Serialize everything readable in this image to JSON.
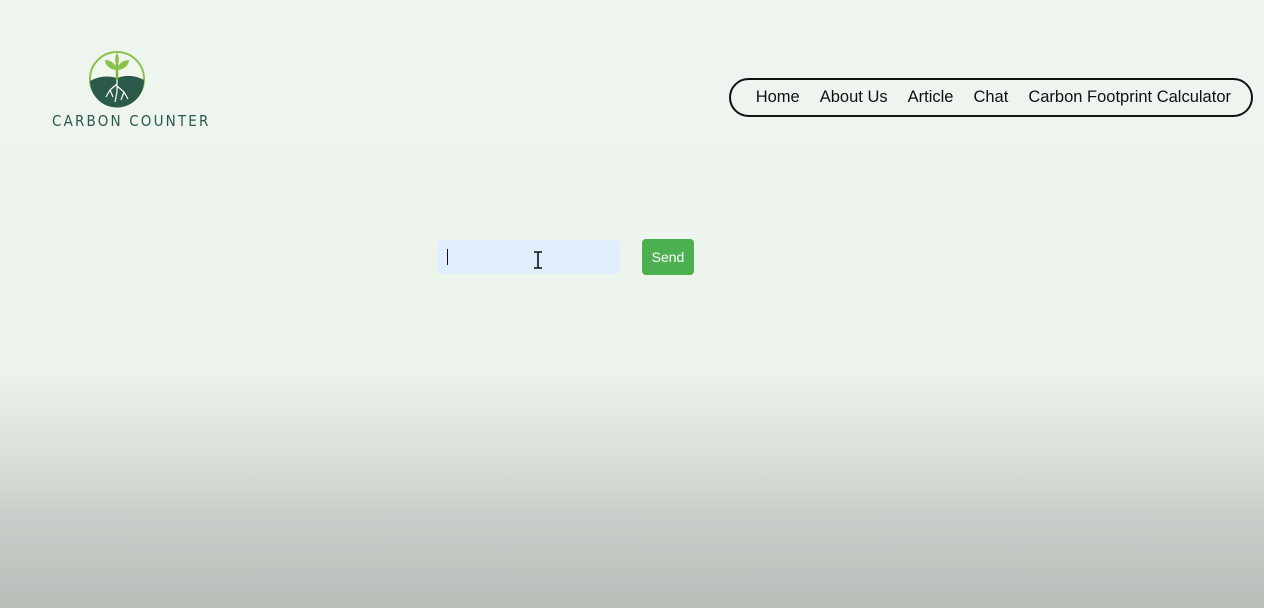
{
  "brand": {
    "name": "CARBON COUNTER",
    "logo_icon": "sprout-roots-icon",
    "colors": {
      "dark_green": "#2b5a4a",
      "leaf_green": "#8bc34a"
    }
  },
  "nav": {
    "items": [
      {
        "label": "Home"
      },
      {
        "label": "About Us"
      },
      {
        "label": "Article"
      },
      {
        "label": "Chat"
      },
      {
        "label": "Carbon Footprint Calculator"
      }
    ]
  },
  "chat": {
    "input_value": "",
    "input_placeholder": "",
    "send_label": "Send",
    "send_color": "#4caf50",
    "input_color": "#e1eefb"
  }
}
